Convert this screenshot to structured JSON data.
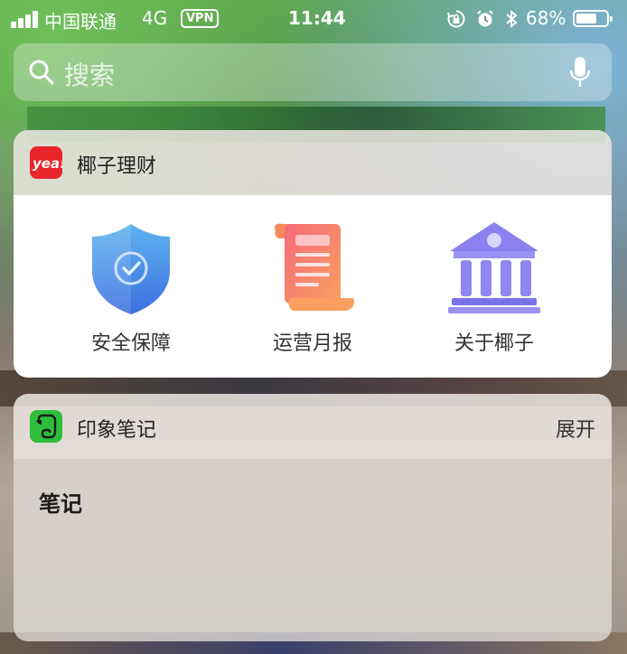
{
  "status_bar": {
    "carrier": "中国联通",
    "network": "4G",
    "vpn": "VPN",
    "time": "11:44",
    "battery_percent": "68%",
    "battery_level": 0.68,
    "icons": [
      "rotation-lock-icon",
      "alarm-icon",
      "bluetooth-icon"
    ]
  },
  "search": {
    "placeholder": "搜索"
  },
  "widgets": [
    {
      "app": "椰子理财",
      "icon": "yea-logo-icon",
      "items": [
        {
          "label": "安全保障",
          "icon": "shield-check-icon"
        },
        {
          "label": "运营月报",
          "icon": "report-scroll-icon"
        },
        {
          "label": "关于椰子",
          "icon": "bank-building-icon"
        }
      ]
    },
    {
      "app": "印象笔记",
      "icon": "evernote-elephant-icon",
      "action": "展开",
      "content_heading": "笔记"
    }
  ],
  "colors": {
    "yezi_red": "#e8262a",
    "evernote_green": "#2dbe3c",
    "shield_blue": "#4a86ea",
    "scroll_coral": "#f5856e",
    "bank_purple": "#8f86f2"
  }
}
